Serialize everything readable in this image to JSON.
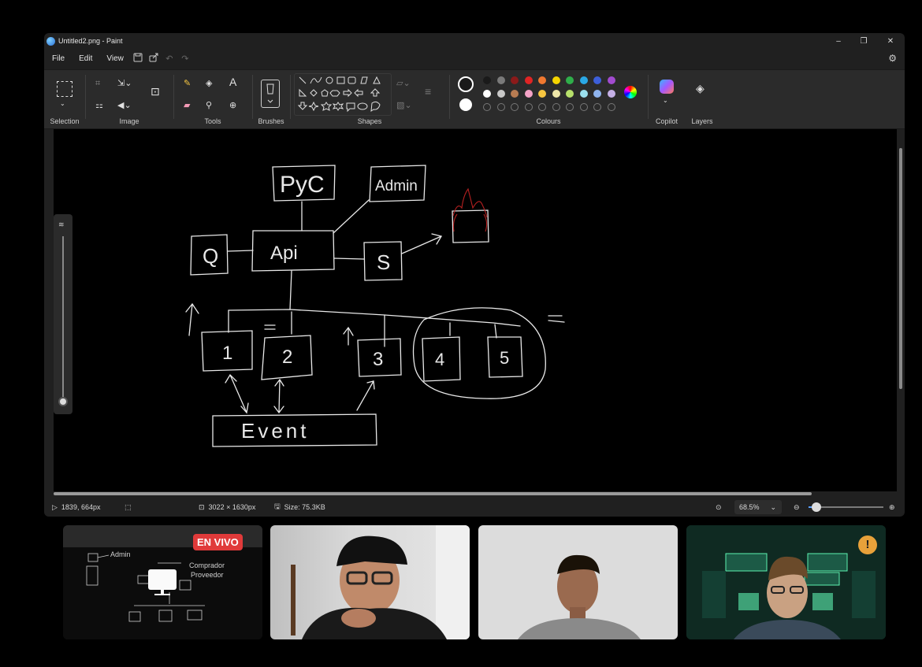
{
  "window": {
    "title": "Untitled2.png - Paint",
    "controls": {
      "minimize": "–",
      "maximize": "❐",
      "close": "✕"
    }
  },
  "menu": {
    "items": [
      "File",
      "Edit",
      "View"
    ],
    "quick": [
      "save-icon",
      "share-icon",
      "undo-icon",
      "redo-icon"
    ],
    "settings_icon": "gear-icon"
  },
  "ribbon": {
    "groups": {
      "selection": "Selection",
      "image": "Image",
      "tools": "Tools",
      "brushes": "Brushes",
      "shapes": "Shapes",
      "colours": "Colours",
      "copilot": "Copilot",
      "layers": "Layers"
    },
    "text_tool": "A",
    "colours_row1": [
      "#1a1a1a",
      "#7a7a7a",
      "#8b1a1a",
      "#e02424",
      "#f07830",
      "#f5d400",
      "#2fae4a",
      "#2aa8e6",
      "#3d5fd9",
      "#a24bd0"
    ],
    "colours_row2": [
      "#ffffff",
      "#c8c8c8",
      "#b87c52",
      "#f5a3c7",
      "#f7c640",
      "#eee6a8",
      "#b7e06b",
      "#9be0ee",
      "#8fb4ee",
      "#c5b0e6"
    ],
    "colours_row3_count": 9,
    "primary": "#1a1a1a",
    "secondary": "#ffffff"
  },
  "drawing": {
    "boxes": [
      "PyC",
      "Admin",
      "Q",
      "Api",
      "S",
      "1",
      "2",
      "3",
      "4",
      "5",
      "Event"
    ],
    "marks": [
      "=",
      "="
    ]
  },
  "status": {
    "cursor_pos": "1839, 664px",
    "canvas_size": "3022 × 1630px",
    "file_size": "Size: 75.3KB",
    "zoom": "68.5%",
    "zoom_slider_fraction": 0.1
  },
  "meeting": {
    "live_badge": "EN VIVO",
    "thumb_labels": {
      "admin": "Admin",
      "comprador": "Comprador",
      "proveedor": "Proveedor"
    },
    "warning": "!"
  }
}
